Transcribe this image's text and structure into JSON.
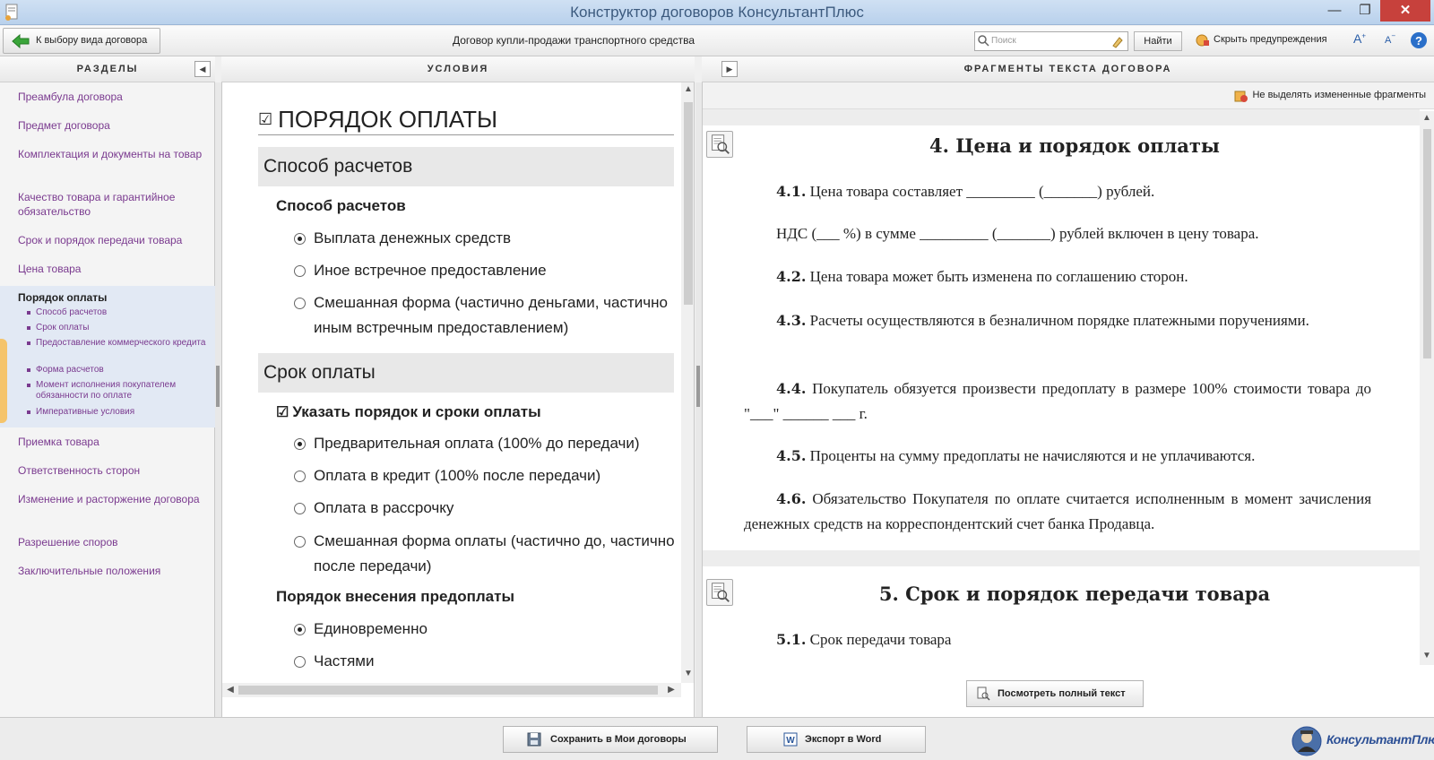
{
  "window": {
    "title": "Конструктор договоров КонсультантПлюс"
  },
  "toolbar": {
    "back_label": "К выбору вида договора",
    "doc_title": "Договор купли-продажи транспортного средства",
    "search_placeholder": "Поиск",
    "find_label": "Найти",
    "hide_warnings_label": "Скрыть предупреждения"
  },
  "sections": {
    "header": "РАЗДЕЛЫ",
    "items": [
      "Преамбула договора",
      "Предмет договора",
      "Комплектация и документы на товар",
      "Качество товара и гарантийное обязательство",
      "Срок и порядок передачи товара",
      "Цена товара"
    ],
    "active": {
      "title": "Порядок оплаты",
      "subitems": [
        "Способ расчетов",
        "Срок оплаты",
        "Предоставление коммерческого кредита",
        "Форма расчетов",
        "Момент исполнения покупателем обязанности по оплате",
        "Императивные условия"
      ]
    },
    "items_after": [
      "Приемка товара",
      "Ответственность сторон",
      "Изменение и расторжение договора",
      "Разрешение споров",
      "Заключительные положения"
    ]
  },
  "conditions": {
    "header": "УСЛОВИЯ",
    "section_title": "ПОРЯДОК ОПЛАТЫ",
    "group1": {
      "title": "Способ расчетов",
      "subtitle": "Способ расчетов",
      "options": [
        "Выплата денежных средств",
        "Иное встречное предоставление",
        "Смешанная форма (частично деньгами, частично иным встречным предоставлением)"
      ]
    },
    "group2": {
      "title": "Срок оплаты",
      "checkbox_label": "Указать порядок и сроки оплаты",
      "options": [
        "Предварительная оплата (100% до передачи)",
        "Оплата в кредит (100% после передачи)",
        "Оплата в рассрочку",
        "Смешанная форма оплаты (частично до, частично после передачи)"
      ],
      "subtitle2": "Порядок внесения предоплаты",
      "options2": [
        "Единовременно",
        "Частями"
      ]
    }
  },
  "fragments": {
    "header": "ФРАГМЕНТЫ ТЕКСТА ДОГОВОРА",
    "no_highlight_label": "Не выделять измененные фрагменты",
    "section4_title": "4. Цена и порядок оплаты",
    "p41_num": "4.1.",
    "p41_text": "Цена товара составляет _________ (_______) рублей.",
    "pvat": "НДС (___ %) в сумме _________ (_______) рублей включен в цену товара.",
    "p42_num": "4.2.",
    "p42_text": "Цена товара может быть изменена по соглашению сторон.",
    "p43_num": "4.3.",
    "p43_text": "Расчеты осуществляются в безналичном порядке платежными поручениями.",
    "p44_num": "4.4.",
    "p44_text": "Покупатель обязуется произвести предоплату в размере 100% стоимости товара до \"___\" ______ ___ г.",
    "p45_num": "4.5.",
    "p45_text": "Проценты на сумму предоплаты не начисляются и не уплачиваются.",
    "p46_num": "4.6.",
    "p46_text": "Обязательство Покупателя по оплате считается исполненным в момент зачисления денежных средств на корреспондентский счет банка Продавца.",
    "section5_title": "5. Срок и порядок передачи товара",
    "p51_num": "5.1.",
    "p51_text": "Срок передачи товара",
    "view_full_label": "Посмотреть полный текст"
  },
  "bottom": {
    "save_label": "Сохранить в Мои договоры",
    "export_label": "Экспорт в Word",
    "brand": "КонсультантПлюс"
  },
  "colors": {
    "link": "#7a3a8f",
    "accent": "#2b4f95",
    "close": "#c7413c"
  }
}
